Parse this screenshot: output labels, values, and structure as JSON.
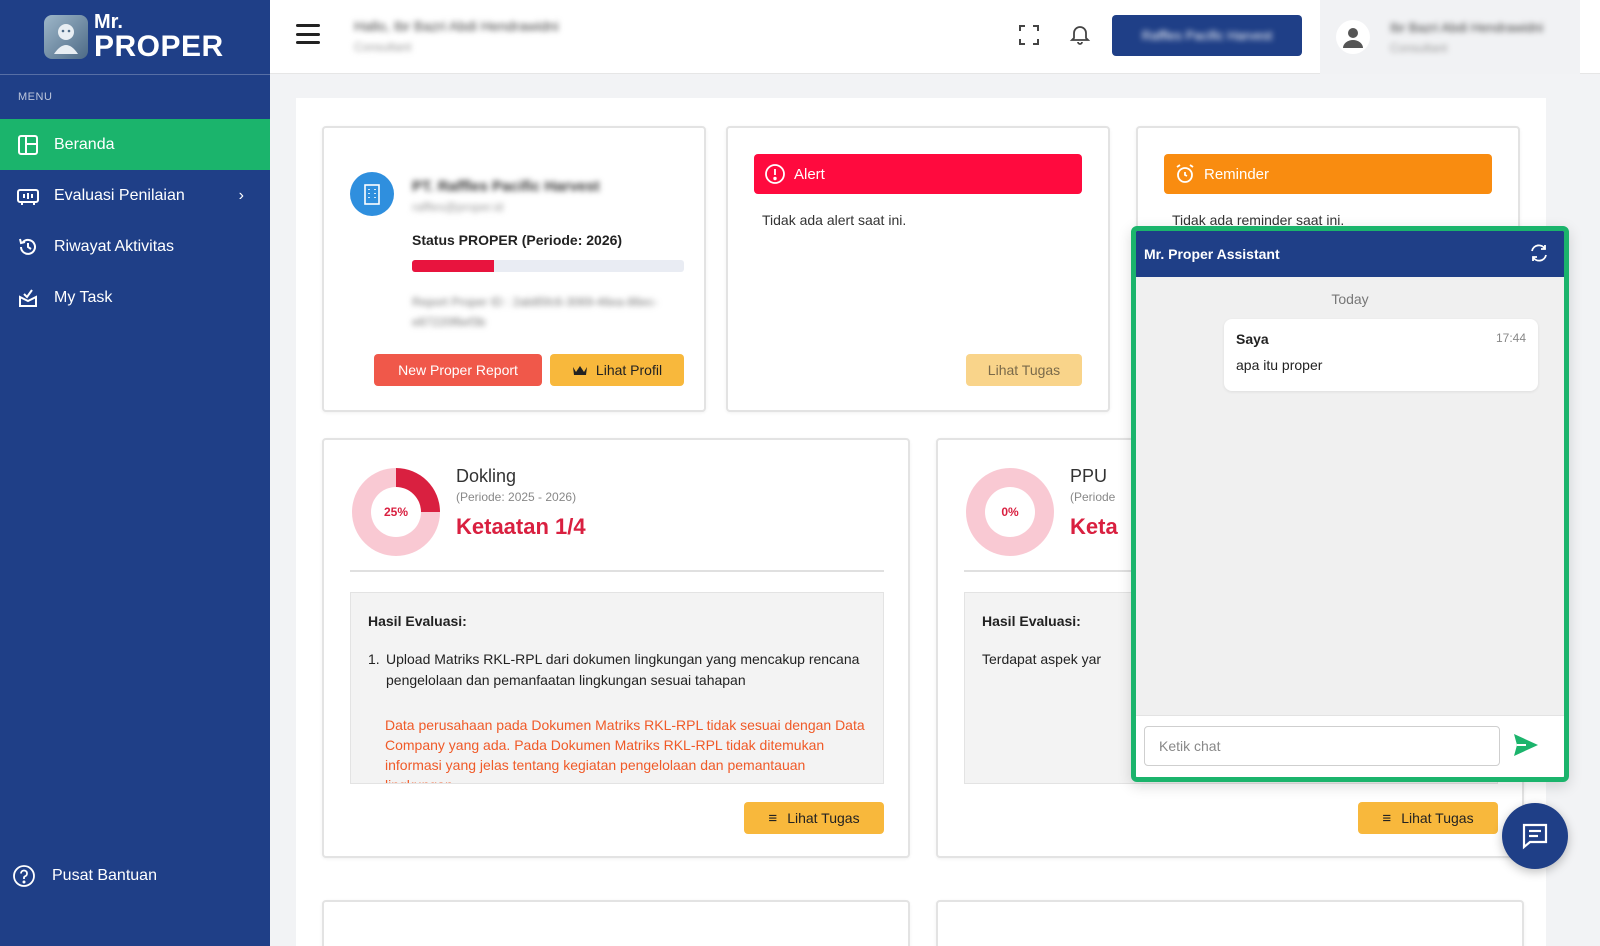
{
  "sidebar": {
    "logo_mr": "Mr.",
    "logo_proper": "PROPER",
    "menu_label": "MENU",
    "items": [
      {
        "label": "Beranda",
        "icon": "layout-icon"
      },
      {
        "label": "Evaluasi Penilaian",
        "icon": "evaluation-icon"
      },
      {
        "label": "Riwayat Aktivitas",
        "icon": "history-icon"
      },
      {
        "label": "My Task",
        "icon": "task-icon"
      }
    ],
    "help_label": "Pusat Bantuan"
  },
  "topbar": {
    "greeting": "Hallo, Ibr Bazri Abdi Hendrawidni",
    "role": "Consultant",
    "company_button": "Raffles Pacific Harvest",
    "user_name": "Ibr Bazri Abdi Hendrawidni",
    "user_role": "Consultant"
  },
  "profile_card": {
    "company_name": "PT. Raffles Pacific Harvest",
    "company_email": "raffles@proper.id",
    "status_label": "Status PROPER (Periode: 2026)",
    "progress": 0.3,
    "report_id": "Report Proper ID : 2ab85fc6-3069-46ea-86ec-e87220f6ef3b",
    "new_report_button": "New Proper Report",
    "profile_button": "Lihat Profil"
  },
  "alert_card": {
    "title": "Alert",
    "message": "Tidak ada alert saat ini.",
    "button": "Lihat Tugas"
  },
  "reminder_card": {
    "title": "Reminder",
    "message": "Tidak ada reminder saat ini."
  },
  "dokling_card": {
    "percent_label": "25%",
    "percent": 25,
    "name": "Dokling",
    "period": "(Periode: 2025 - 2026)",
    "status": "Ketaatan 1/4",
    "eval_title": "Hasil Evaluasi:",
    "eval_num": "1.",
    "eval_item": "Upload Matriks RKL-RPL dari dokumen lingkungan yang mencakup rencana pengelolaan dan pemanfaatan lingkungan sesuai tahapan",
    "eval_note": "Data perusahaan pada Dokumen Matriks RKL-RPL tidak sesuai dengan Data Company yang ada. Pada Dokumen Matriks RKL-RPL tidak ditemukan informasi yang jelas tentang kegiatan pengelolaan dan pemantauan lingkungan",
    "button": "Lihat Tugas"
  },
  "ppu_card": {
    "percent_label": "0%",
    "percent": 0,
    "name": "PPU",
    "period": "(Periode",
    "status": "Keta",
    "eval_title": "Hasil Evaluasi:",
    "eval_text": "Terdapat aspek yar",
    "button": "Lihat Tugas"
  },
  "chat": {
    "title": "Mr. Proper Assistant",
    "date_label": "Today",
    "messages": [
      {
        "sender": "Saya",
        "time": "17:44",
        "text": "apa itu proper"
      }
    ],
    "input_placeholder": "Ketik chat"
  },
  "colors": {
    "sidebar": "#1f3f87",
    "active": "#1bb46c",
    "alert": "#ff0a3e",
    "reminder": "#f98c10",
    "accent_red": "#d92040"
  }
}
